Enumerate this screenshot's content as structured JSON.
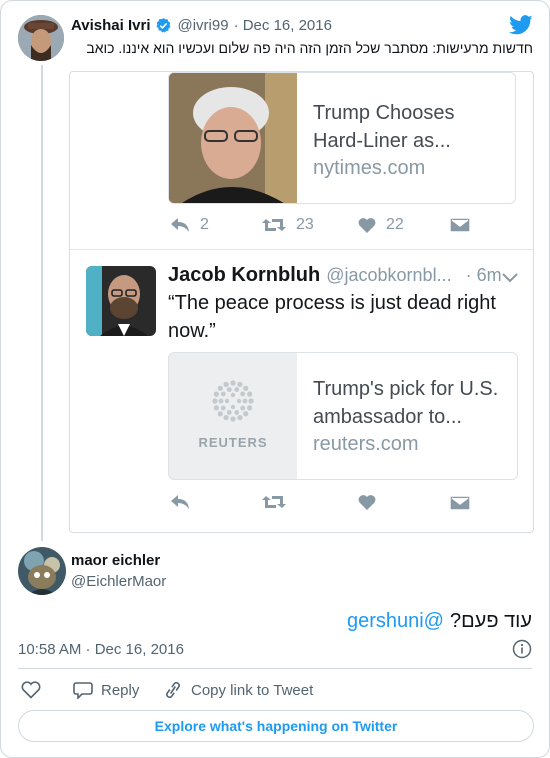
{
  "tweet": {
    "author_name": "Avishai Ivri",
    "author_handle": "@ivri99",
    "date": "· Dec 16, 2016",
    "text": "חדשות מרעישות: מסתבר שכל הזמן הזה היה פה שלום ועכשיו הוא איננו. כואב"
  },
  "embedded_screenshot": {
    "link_card_1": {
      "title_line1": "Trump Chooses",
      "title_line2": "Hard-Liner as...",
      "domain": "nytimes.com"
    },
    "actions_1": {
      "reply_count": "2",
      "retweet_count": "23",
      "like_count": "22"
    },
    "quoted_tweet": {
      "name": "Jacob Kornbluh",
      "handle": "@jacobkornbl...",
      "time": "· 6m",
      "text_line1": "“The peace process is just dead right",
      "text_line2": "now.”"
    },
    "link_card_2": {
      "logo_text": "REUTERS",
      "title_line1": "Trump's pick for U.S.",
      "title_line2": "ambassador to...",
      "domain": "reuters.com"
    }
  },
  "reply": {
    "author_name": "maor eichler",
    "author_handle": "@EichlerMaor",
    "mention": "@gershuni",
    "text": "עוד פעם?",
    "timestamp": "10:58 AM · Dec 16, 2016"
  },
  "footer": {
    "reply_label": "Reply",
    "copy_link_label": "Copy link to Tweet",
    "explore_label": "Explore what's happening on Twitter"
  },
  "colors": {
    "accent": "#1d9bf0",
    "verified": "#1d9bf0"
  }
}
